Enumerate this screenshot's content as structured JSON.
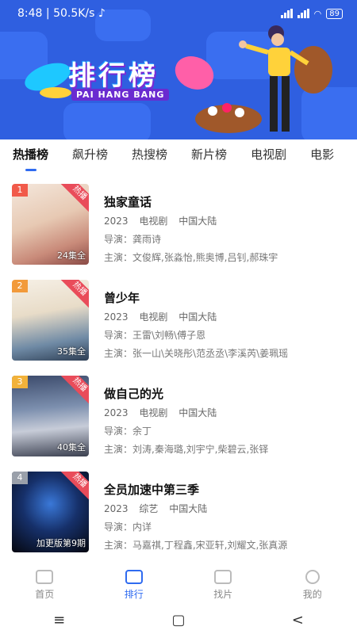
{
  "status": {
    "time": "8:48",
    "speed": "50.5K/s",
    "battery": "89"
  },
  "banner": {
    "title": "排行榜",
    "subtitle": "PAI HANG BANG"
  },
  "tabs": [
    {
      "label": "热播榜"
    },
    {
      "label": "飙升榜"
    },
    {
      "label": "热搜榜"
    },
    {
      "label": "新片榜"
    },
    {
      "label": "电视剧"
    },
    {
      "label": "电影"
    }
  ],
  "items": [
    {
      "rank": "1",
      "badge": "热播",
      "episodes": "24集全",
      "title": "独家童话",
      "year": "2023",
      "type": "电视剧",
      "region": "中国大陆",
      "director": "导演：龚雨诗",
      "cast": "主演：文俊辉,张淼怡,熊奥博,吕钊,郝珠宇"
    },
    {
      "rank": "2",
      "badge": "热播",
      "episodes": "35集全",
      "title": "曾少年",
      "year": "2023",
      "type": "电视剧",
      "region": "中国大陆",
      "director": "导演：王雷\\刘畅\\傅子恩",
      "cast": "主演：张一山\\关晓彤\\范丞丞\\李溪芮\\姜珮瑶"
    },
    {
      "rank": "3",
      "badge": "热播",
      "episodes": "40集全",
      "title": "做自己的光",
      "year": "2023",
      "type": "电视剧",
      "region": "中国大陆",
      "director": "导演：余丁",
      "cast": "主演：刘涛,秦海璐,刘宇宁,柴碧云,张铎"
    },
    {
      "rank": "4",
      "badge": "热播",
      "episodes": "加更版第9期",
      "title": "全员加速中第三季",
      "year": "2023",
      "type": "综艺",
      "region": "中国大陆",
      "director": "导演：内详",
      "cast": "主演：马嘉祺,丁程鑫,宋亚轩,刘耀文,张真源"
    }
  ],
  "nav": [
    {
      "label": "首页"
    },
    {
      "label": "排行"
    },
    {
      "label": "找片"
    },
    {
      "label": "我的"
    }
  ],
  "sysnav": {
    "menu": "≡",
    "home": "▢",
    "back": "<"
  }
}
